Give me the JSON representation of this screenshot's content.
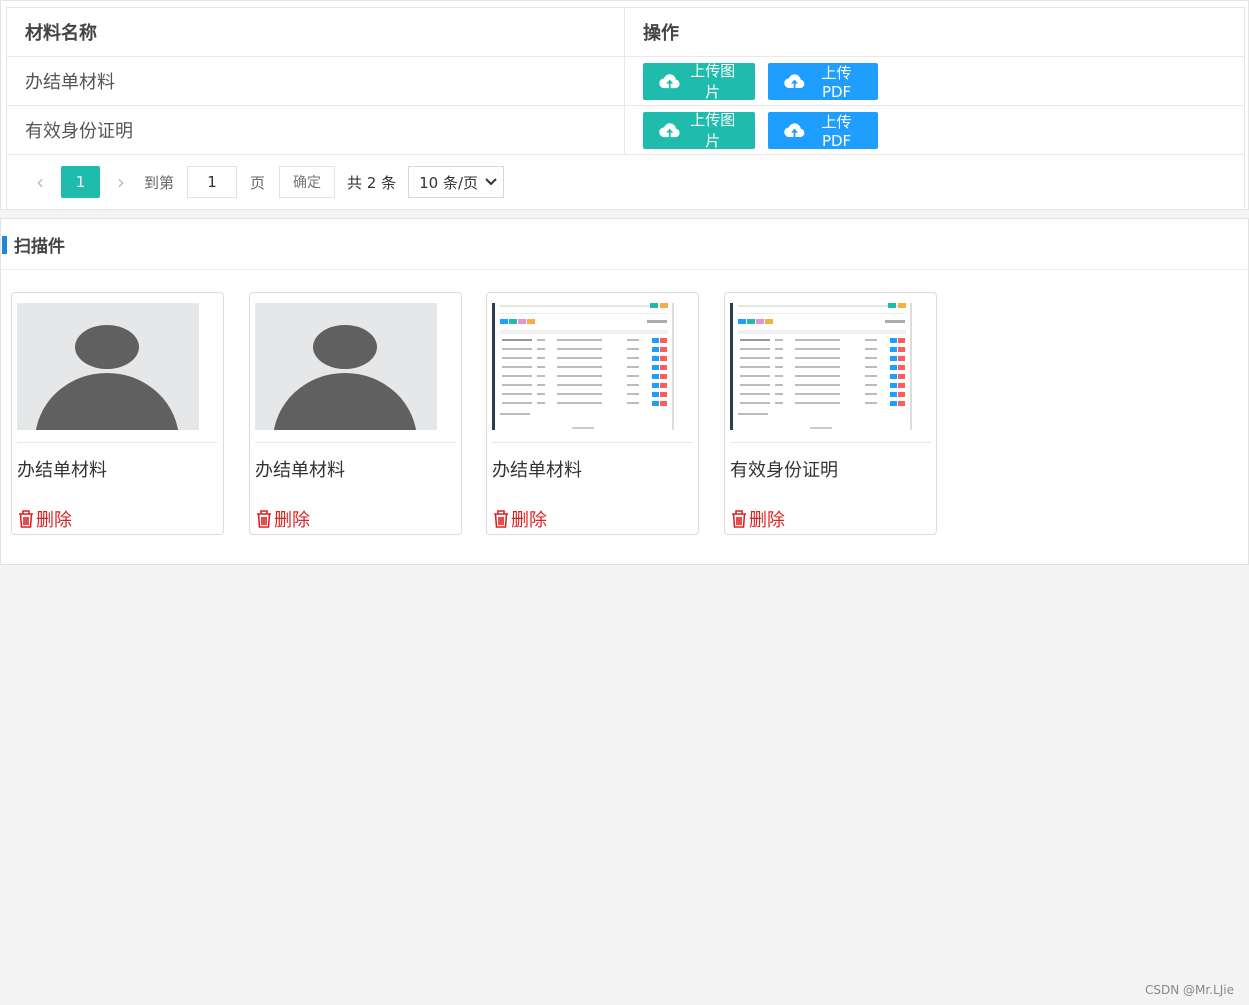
{
  "table": {
    "headers": {
      "name": "材料名称",
      "actions": "操作"
    },
    "rows": [
      {
        "name": "办结单材料",
        "upload_image": "上传图片",
        "upload_pdf": "上传PDF"
      },
      {
        "name": "有效身份证明",
        "upload_image": "上传图片",
        "upload_pdf": "上传PDF"
      }
    ]
  },
  "pager": {
    "prev_icon": "chevron-left-icon",
    "current_page": "1",
    "next_icon": "chevron-right-icon",
    "goto_label": "到第",
    "goto_value": "1",
    "page_unit": "页",
    "confirm": "确定",
    "total": "共 2 条",
    "page_size": "10 条/页"
  },
  "scans": {
    "title": "扫描件",
    "cards": [
      {
        "name": "办结单材料",
        "thumb": "avatar-placeholder",
        "delete": "删除"
      },
      {
        "name": "办结单材料",
        "thumb": "avatar-placeholder",
        "delete": "删除"
      },
      {
        "name": "办结单材料",
        "thumb": "screenshot",
        "delete": "删除"
      },
      {
        "name": "有效身份证明",
        "thumb": "screenshot",
        "delete": "删除"
      }
    ]
  },
  "colors": {
    "accent_teal": "#1fbcae",
    "accent_blue": "#1e9fff",
    "danger": "#e02020",
    "title_bar": "#1e87d8"
  },
  "watermark": "CSDN @Mr.LJie"
}
